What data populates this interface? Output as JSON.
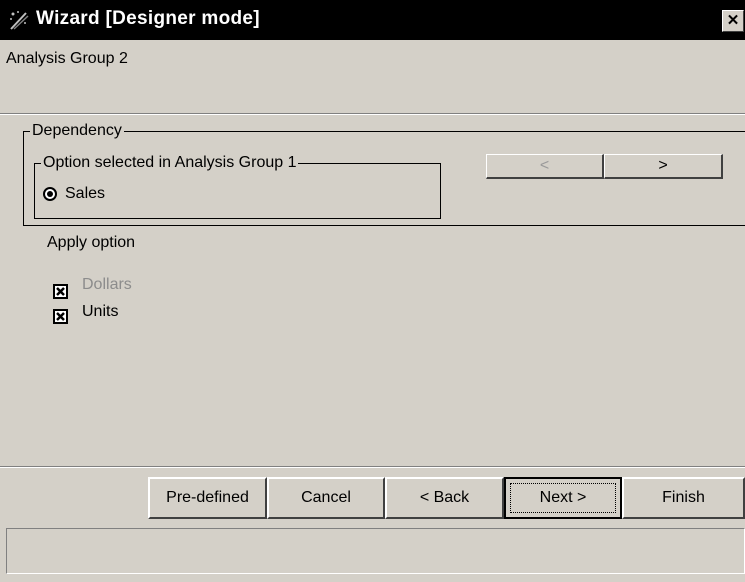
{
  "window": {
    "title": "Wizard  [Designer mode]",
    "close_glyph": "✕",
    "icon": "wizard-wand-icon",
    "background": "#d4d0c8",
    "titlebar_color": "#000000"
  },
  "header": {
    "subtitle": "Analysis Group 2"
  },
  "dependency": {
    "legend": "Dependency",
    "option_group": {
      "legend": "Option selected in Analysis Group 1",
      "selected_option": "Sales"
    },
    "nav": {
      "prev_label": "<",
      "next_label": ">",
      "prev_enabled": false,
      "next_enabled": true
    }
  },
  "apply": {
    "label": "Apply option",
    "options": [
      {
        "label": "Dollars",
        "checked": true,
        "enabled": false
      },
      {
        "label": "Units",
        "checked": true,
        "enabled": true
      }
    ]
  },
  "footer": {
    "buttons": {
      "predefined": "Pre-defined",
      "cancel": "Cancel",
      "back": "< Back",
      "next": "Next >",
      "finish": "Finish"
    },
    "default_button": "next"
  },
  "status_bar": {
    "text": ""
  }
}
